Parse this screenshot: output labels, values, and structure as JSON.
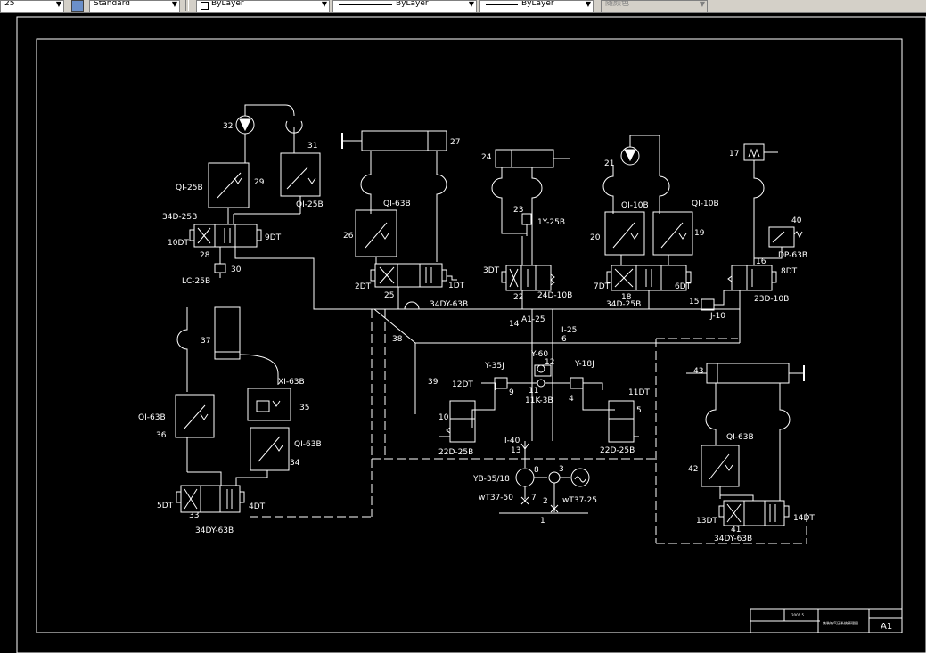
{
  "toolbar": {
    "layer_field": {
      "value": "25"
    },
    "text_style": {
      "value": "Standard"
    },
    "layer": {
      "value": "ByLayer"
    },
    "linetype": {
      "value": "ByLayer"
    },
    "lineweight": {
      "value": "ByLayer"
    },
    "plot_style": {
      "value": "随颜色"
    }
  },
  "drawing": {
    "labels": [
      {
        "id": "32",
        "t": "32"
      },
      {
        "id": "31",
        "t": "31"
      },
      {
        "id": "29",
        "t": "29"
      },
      {
        "id": "qi25b-left",
        "t": "QI-25B"
      },
      {
        "id": "qi25b-right",
        "t": "QI-25B"
      },
      {
        "id": "34d25b-top",
        "t": "34D-25B"
      },
      {
        "id": "10dt",
        "t": "10DT"
      },
      {
        "id": "9dt",
        "t": "9DT"
      },
      {
        "id": "28",
        "t": "28"
      },
      {
        "id": "30",
        "t": "30"
      },
      {
        "id": "lc25b",
        "t": "LC-25B"
      },
      {
        "id": "27",
        "t": "27"
      },
      {
        "id": "qi63b-26",
        "t": "QI-63B"
      },
      {
        "id": "26",
        "t": "26"
      },
      {
        "id": "2dt",
        "t": "2DT"
      },
      {
        "id": "1dt",
        "t": "1DT"
      },
      {
        "id": "25",
        "t": "25"
      },
      {
        "id": "34dy63b-top",
        "t": "34DY-63B"
      },
      {
        "id": "24",
        "t": "24"
      },
      {
        "id": "23",
        "t": "23"
      },
      {
        "id": "1y25b",
        "t": "1Y-25B"
      },
      {
        "id": "3dt",
        "t": "3DT"
      },
      {
        "id": "22",
        "t": "22"
      },
      {
        "id": "24d10b",
        "t": "24D-10B"
      },
      {
        "id": "21",
        "t": "21"
      },
      {
        "id": "qi10b-a",
        "t": "QI-10B"
      },
      {
        "id": "qi10b-b",
        "t": "QI-10B"
      },
      {
        "id": "20",
        "t": "20"
      },
      {
        "id": "19",
        "t": "19"
      },
      {
        "id": "7dt",
        "t": "7DT"
      },
      {
        "id": "18",
        "t": "18"
      },
      {
        "id": "6dt",
        "t": "6DT"
      },
      {
        "id": "34d25b-mid",
        "t": "34D-25B"
      },
      {
        "id": "17",
        "t": "17"
      },
      {
        "id": "40",
        "t": "40"
      },
      {
        "id": "dp63b",
        "t": "DP-63B"
      },
      {
        "id": "16",
        "t": "16"
      },
      {
        "id": "8dt",
        "t": "8DT"
      },
      {
        "id": "23d10b",
        "t": "23D-10B"
      },
      {
        "id": "15",
        "t": "15"
      },
      {
        "id": "j10",
        "t": "J-10"
      },
      {
        "id": "14",
        "t": "14"
      },
      {
        "id": "a25",
        "t": "A1-25"
      },
      {
        "id": "i25",
        "t": "I-25"
      },
      {
        "id": "6",
        "t": "6"
      },
      {
        "id": "38",
        "t": "38"
      },
      {
        "id": "37",
        "t": "37"
      },
      {
        "id": "39",
        "t": "39"
      },
      {
        "id": "y60",
        "t": "Y-60"
      },
      {
        "id": "12",
        "t": "12"
      },
      {
        "id": "y35j",
        "t": "Y-35J"
      },
      {
        "id": "y18j",
        "t": "Y-18J"
      },
      {
        "id": "9",
        "t": "9"
      },
      {
        "id": "11",
        "t": "11"
      },
      {
        "id": "11k3b",
        "t": "11K-3B"
      },
      {
        "id": "4",
        "t": "4"
      },
      {
        "id": "12dt",
        "t": "12DT"
      },
      {
        "id": "11dt",
        "t": "11DT"
      },
      {
        "id": "10",
        "t": "10"
      },
      {
        "id": "5",
        "t": "5"
      },
      {
        "id": "22d25b-l",
        "t": "22D-25B"
      },
      {
        "id": "22d25b-r",
        "t": "22D-25B"
      },
      {
        "id": "i40",
        "t": "I-40"
      },
      {
        "id": "13",
        "t": "13"
      },
      {
        "id": "8",
        "t": "8"
      },
      {
        "id": "3",
        "t": "3"
      },
      {
        "id": "yb35",
        "t": "YB-35/18"
      },
      {
        "id": "wt3750",
        "t": "wT37-50"
      },
      {
        "id": "7",
        "t": "7"
      },
      {
        "id": "2",
        "t": "2"
      },
      {
        "id": "wt3725",
        "t": "wT37-25"
      },
      {
        "id": "1",
        "t": "1"
      },
      {
        "id": "xi63b",
        "t": "XI-63B"
      },
      {
        "id": "35",
        "t": "35"
      },
      {
        "id": "qi63b-36",
        "t": "QI-63B"
      },
      {
        "id": "36",
        "t": "36"
      },
      {
        "id": "qi63b-34",
        "t": "QI-63B"
      },
      {
        "id": "34",
        "t": "34"
      },
      {
        "id": "5dt",
        "t": "5DT"
      },
      {
        "id": "33",
        "t": "33"
      },
      {
        "id": "4dt",
        "t": "4DT"
      },
      {
        "id": "34dy63b-bl",
        "t": "34DY-63B"
      },
      {
        "id": "43",
        "t": "43"
      },
      {
        "id": "qi63b-42",
        "t": "QI-63B"
      },
      {
        "id": "42",
        "t": "42"
      },
      {
        "id": "13dt",
        "t": "13DT"
      },
      {
        "id": "41",
        "t": "41"
      },
      {
        "id": "14dt",
        "t": "14DT"
      },
      {
        "id": "34dy63b-br",
        "t": "34DY-63B"
      }
    ],
    "title_block": {
      "date": "2007.5",
      "title": "集装箱气压系统原理图",
      "sheet_size": "A1"
    }
  }
}
